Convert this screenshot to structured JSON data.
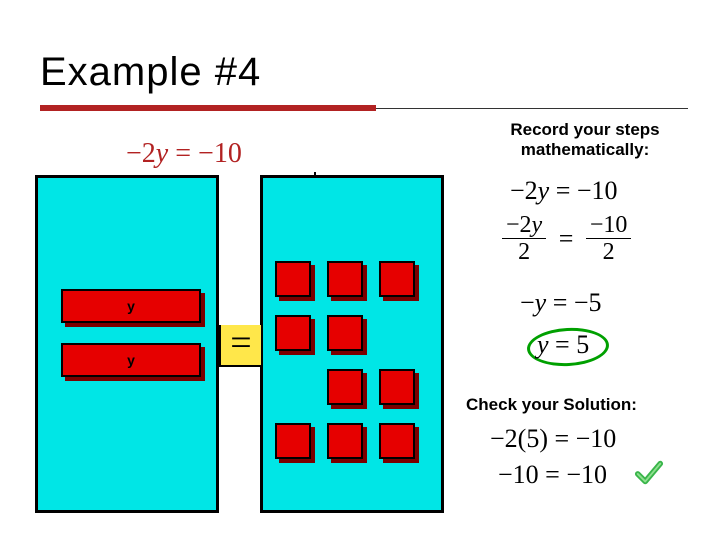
{
  "title": "Example #4",
  "model_equation": "−2y = −10",
  "record_label": "Record your steps mathematically:",
  "steps": {
    "s1": "−2y = −10",
    "s2_left_top": "−2y",
    "s2_left_bot": "2",
    "s2_eq": "=",
    "s2_right_top": "−10",
    "s2_right_bot": "2",
    "s3": "−y = −5",
    "s4": "y = 5"
  },
  "check_label": "Check your Solution:",
  "check": {
    "c1": "−2(5) = −10",
    "c2": "−10 = −10"
  },
  "tiles": {
    "y_label": "y",
    "equals": "="
  },
  "icons": {
    "checkmark": "check-icon"
  }
}
